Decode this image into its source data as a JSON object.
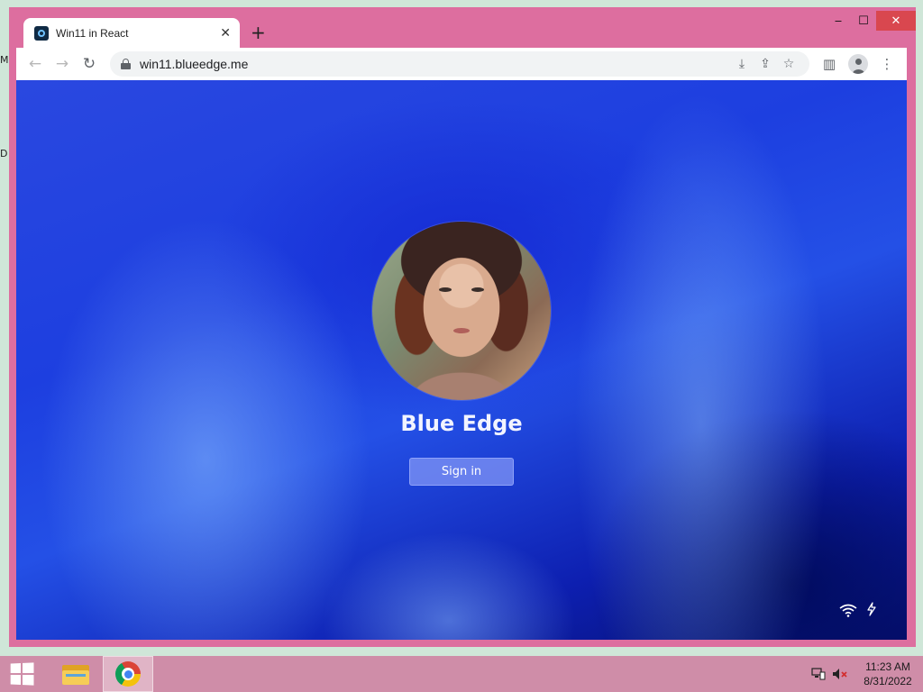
{
  "browser": {
    "tab": {
      "title": "Win11 in React",
      "close": "✕"
    },
    "new_tab": "+",
    "window_controls": {
      "minimize": "‒",
      "maximize": "☐",
      "close": "✕"
    },
    "nav": {
      "back": "←",
      "forward": "→",
      "reload": "↻"
    },
    "address_bar": {
      "url": "win11.blueedge.me"
    },
    "omnibox_actions": {
      "install": "⤓",
      "share": "⇪",
      "bookmark": "☆"
    },
    "toolbar_actions": {
      "side_panel": "▥",
      "menu": "⋮"
    }
  },
  "lock_screen": {
    "user_name": "Blue Edge",
    "sign_in_label": "Sign in"
  },
  "taskbar": {
    "time": "11:23 AM",
    "date": "8/31/2022"
  },
  "colors": {
    "window_frame": "#dd6e9f",
    "taskbar": "#cf8da8",
    "close_button": "#d9474f",
    "wallpaper_blue": "#1d3fe0"
  }
}
